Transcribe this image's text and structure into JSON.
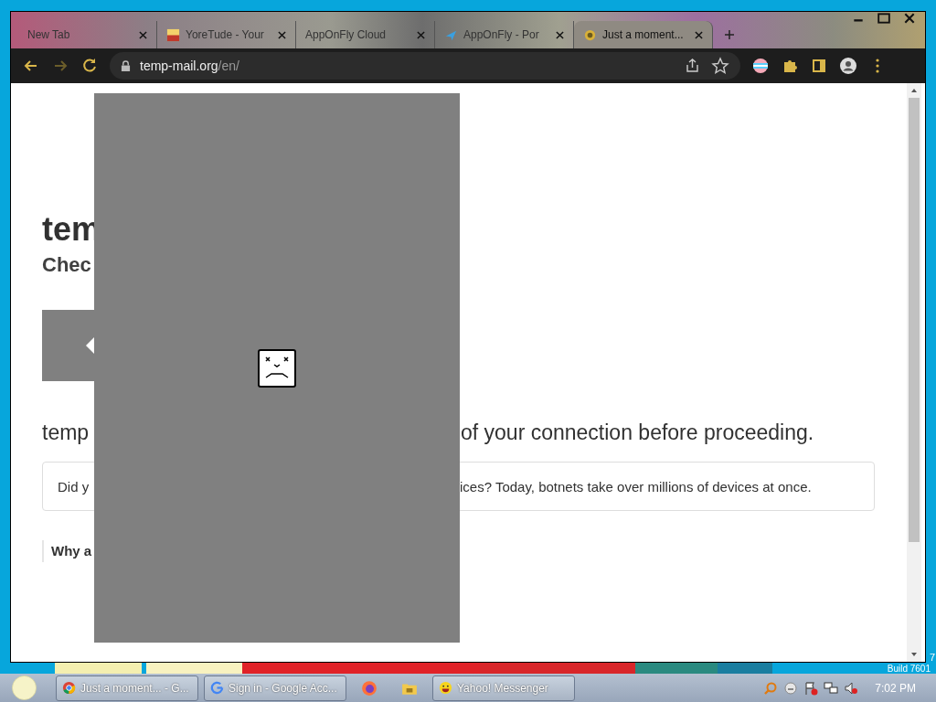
{
  "browser": {
    "tabs": [
      {
        "title": "New Tab",
        "selected": false
      },
      {
        "title": "YoreTude - Your",
        "selected": false
      },
      {
        "title": "AppOnFly Cloud",
        "selected": false
      },
      {
        "title": "AppOnFly - Por",
        "selected": false
      },
      {
        "title": "Just a moment...",
        "selected": true
      }
    ],
    "address": {
      "domain": "temp-mail.org",
      "path": "/en/"
    }
  },
  "page": {
    "heading": "tem",
    "subheading": "Chec",
    "message_start": "temp",
    "message_end": "of your connection before proceeding.",
    "notice_start": "Did y",
    "notice_end": "ices? Today, botnets take over millions of devices at once.",
    "details_start": "Why a"
  },
  "desktop": {
    "edition": "7",
    "build": "Build 7601"
  },
  "taskbar": {
    "items": [
      {
        "kind": "window",
        "title": "Just a moment... - G..."
      },
      {
        "kind": "window",
        "title": "Sign in - Google Acc..."
      },
      {
        "kind": "pinned"
      },
      {
        "kind": "pinned"
      },
      {
        "kind": "window",
        "title": "Yahoo! Messenger"
      }
    ],
    "clock": "7:02 PM"
  }
}
